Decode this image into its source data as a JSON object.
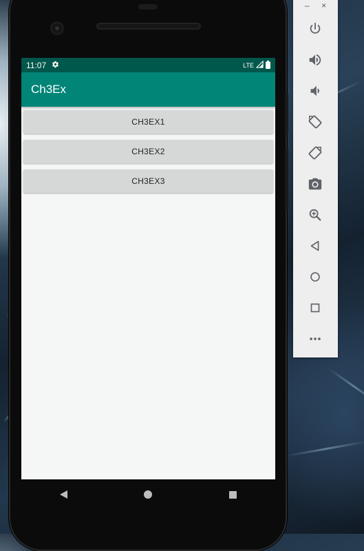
{
  "status_bar": {
    "time": "11:07",
    "settings_icon": "gear-icon",
    "network": "LTE",
    "signal_icon": "signal-icon",
    "battery_icon": "battery-icon"
  },
  "app_bar": {
    "title": "Ch3Ex"
  },
  "buttons": [
    {
      "label": "CH3EX1"
    },
    {
      "label": "CH3EX2"
    },
    {
      "label": "CH3EX3"
    }
  ],
  "nav_bar": [
    "back-icon",
    "home-icon",
    "recents-icon"
  ],
  "emulator": {
    "window_controls": {
      "minimize": "–",
      "close": "×"
    },
    "tools": [
      "power-icon",
      "volume-up-icon",
      "volume-down-icon",
      "rotate-left-icon",
      "rotate-right-icon",
      "camera-icon",
      "zoom-icon",
      "back-icon",
      "home-icon",
      "overview-icon",
      "more-icon"
    ]
  },
  "colors": {
    "status_bar": "#00574b",
    "app_bar": "#008577",
    "button": "#d6d7d7",
    "screen_bg": "#f5f6f6",
    "toolbar_bg": "#eeeeee",
    "toolbar_icon": "#5f6368"
  }
}
